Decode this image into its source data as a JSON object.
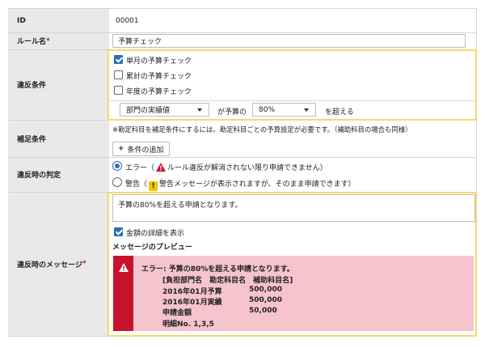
{
  "rows": {
    "id": {
      "label": "ID",
      "value": "00001"
    },
    "rule_name": {
      "label": "ルール名",
      "required": "*",
      "value": "予算チェック"
    },
    "violation": {
      "label": "違反条件",
      "checks": [
        {
          "label": "単月の予算チェック",
          "checked": true
        },
        {
          "label": "累計の予算チェック",
          "checked": false
        },
        {
          "label": "年度の予算チェック",
          "checked": false
        }
      ],
      "select_base": "部門の実績値",
      "text_mid": "が予算の",
      "select_pct": "80%",
      "text_end": "を超える"
    },
    "supplement": {
      "label": "補足条件",
      "note": "※勘定科目を補足条件にするには、勘定科目ごとの予算設定が必要です。（補助科目の場合も同様）",
      "add_button": "条件の追加"
    },
    "judgement": {
      "label": "違反時の判定",
      "error_prefix": "エラー（",
      "error_text": "ルール違反が解消されない限り申請できません）",
      "warn_prefix": "警告（",
      "warn_text": "警告メッセージが表示されますが、そのまま申請できます）",
      "selected": "error"
    },
    "message": {
      "label": "違反時のメッセージ",
      "required": "*",
      "textarea": "予算の80%を超える申請となります。",
      "show_detail": "金額の詳細を表示",
      "preview_heading": "メッセージのプレビュー",
      "preview": {
        "title": "エラー: 予算の80%を超える申請となります。",
        "header": "[負担部門名　勘定科目名　補助科目名]",
        "lines": [
          {
            "label": "2016年01月予算",
            "amount": "500,000"
          },
          {
            "label": "2016年01月実績",
            "amount": "500,000"
          },
          {
            "label": "申請金額",
            "amount": "50,000"
          }
        ],
        "detail": "明細No. 1,3,5"
      }
    }
  },
  "colors": {
    "accent": "#2f6fb6",
    "error": "#c8122c",
    "preview_bg": "#f6c4cc",
    "highlight": "#f7d96a"
  }
}
